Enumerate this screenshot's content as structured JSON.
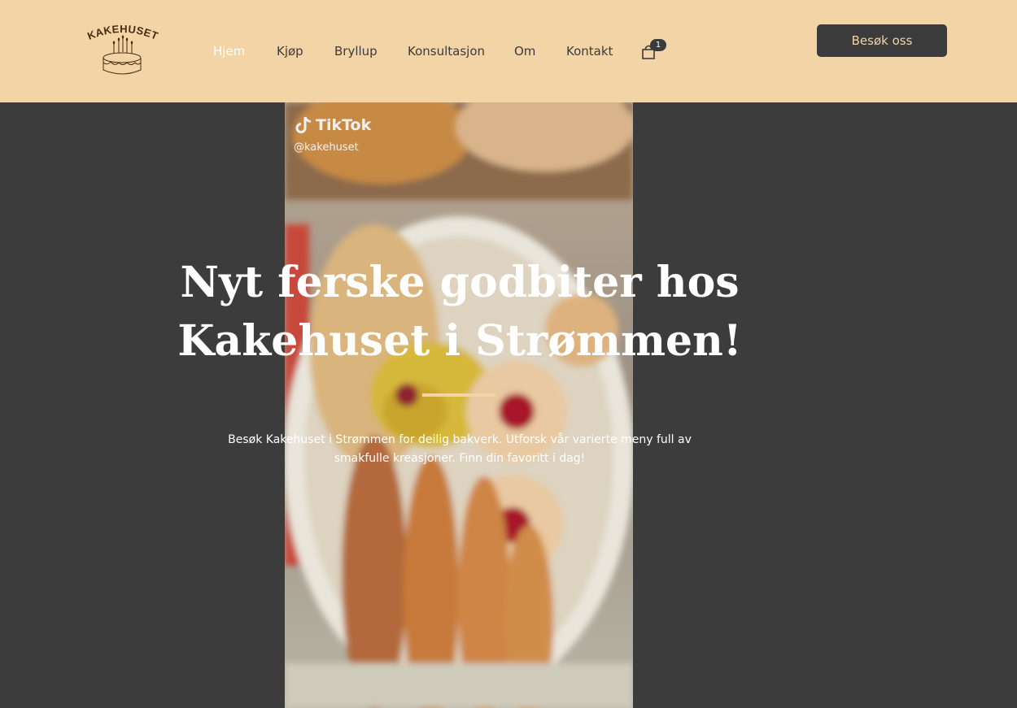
{
  "brand": {
    "logo_text": "KAKEHUSET"
  },
  "nav": {
    "items": [
      {
        "label": "Hjem",
        "active": true
      },
      {
        "label": "Kjøp",
        "active": false
      },
      {
        "label": "Bryllup",
        "active": false
      },
      {
        "label": "Konsultasjon",
        "active": false
      },
      {
        "label": "Om",
        "active": false
      },
      {
        "label": "Kontakt",
        "active": false
      }
    ],
    "cart_count": "1",
    "cart_icon": "shopping-bag-icon"
  },
  "cta": {
    "label": "Besøk oss"
  },
  "hero": {
    "video": {
      "platform": "TikTok",
      "handle": "@kakehuset"
    },
    "headline": "Nyt ferske godbiter hos Kakehuset i Strømmen!",
    "subtext": "Besøk Kakehuset i Strømmen for deilig bakverk. Utforsk vår varierte meny full av smakfulle kreasjoner. Finn din favoritt i dag!"
  },
  "colors": {
    "header_bg": "#f3d4a6",
    "hero_bg": "#3c3c3c",
    "dark": "#3b3b3b",
    "accent": "#f3d4a6"
  }
}
